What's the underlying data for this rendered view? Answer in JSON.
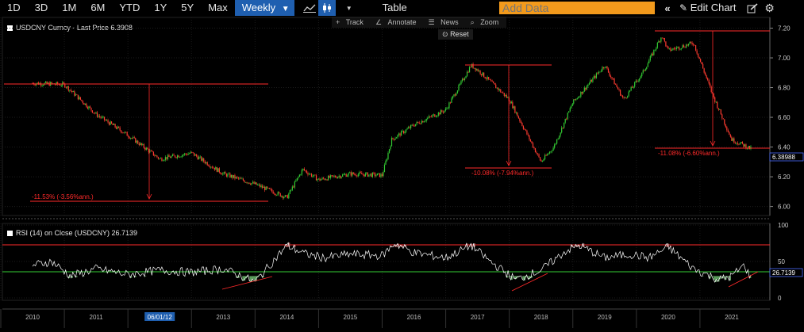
{
  "toolbar": {
    "periods": [
      "1D",
      "3D",
      "1M",
      "6M",
      "YTD",
      "1Y",
      "5Y",
      "Max"
    ],
    "interval": "Weekly",
    "table_label": "Table",
    "add_data_placeholder": "Add Data",
    "edit_chart_label": "Edit Chart"
  },
  "chart_tools": {
    "track": "Track",
    "annotate": "Annotate",
    "news": "News",
    "zoom": "Zoom",
    "reset": "Reset"
  },
  "price_panel": {
    "legend": "USDCNY Curncy - Last Price 6.3908",
    "last_price_tag": "6.38988",
    "y_ticks": [
      "7.20",
      "7.00",
      "6.80",
      "6.60",
      "6.40",
      "6.20",
      "6.00"
    ],
    "annotations": [
      "-11.53% (-3.56%ann.)",
      "-10.08% (-7.94%ann.)",
      "-11.08% (-6.60%ann.)"
    ]
  },
  "rsi_panel": {
    "legend": "RSI (14) on Close (USDCNY) 26.7139",
    "last_value_tag": "26.7139",
    "y_ticks": [
      "100",
      "50",
      "0"
    ]
  },
  "x_axis": {
    "labels": [
      "2010",
      "2011",
      "06/01/12",
      "2013",
      "2014",
      "2015",
      "2016",
      "2017",
      "2018",
      "2019",
      "2020",
      "2021"
    ]
  },
  "colors": {
    "up": "#33cc33",
    "down": "#ff3b30",
    "annotation": "#ff2a2a",
    "rsi_line": "#ffffff",
    "rsi_oversold_fill": "#5a9a5a",
    "rsi_overbought_fill": "#b06060",
    "accent": "#1f5fb0",
    "add_data_bg": "#f29a1c"
  },
  "chart_data": [
    {
      "type": "candlestick",
      "title": "USDCNY Curncy - Last Price 6.3908",
      "ylim": [
        5.95,
        7.24
      ],
      "x": [
        "2010",
        "2010.5",
        "2011",
        "2011.5",
        "2012",
        "2012.5",
        "2013",
        "2013.5",
        "2014",
        "2014.25",
        "2014.5",
        "2015",
        "2015.5",
        "2015.65",
        "2016",
        "2016.5",
        "2016.9",
        "2017",
        "2017.5",
        "2018",
        "2018.2",
        "2018.5",
        "2019",
        "2019.3",
        "2019.6",
        "2019.9",
        "2020",
        "2020.4",
        "2020.7",
        "2021",
        "2021.3"
      ],
      "values": [
        6.83,
        6.82,
        6.62,
        6.48,
        6.32,
        6.36,
        6.22,
        6.15,
        6.06,
        6.25,
        6.18,
        6.22,
        6.21,
        6.45,
        6.55,
        6.65,
        6.95,
        6.92,
        6.72,
        6.3,
        6.4,
        6.7,
        6.95,
        6.72,
        6.9,
        7.15,
        7.05,
        7.1,
        6.75,
        6.45,
        6.39
      ]
    },
    {
      "type": "line",
      "title": "RSI (14) on Close (USDCNY) 26.7139",
      "ylim": [
        0,
        100
      ],
      "x": [
        "2010",
        "2010.3",
        "2010.6",
        "2011",
        "2011.5",
        "2012",
        "2012.5",
        "2013",
        "2013.5",
        "2014",
        "2014.3",
        "2014.6",
        "2015",
        "2015.5",
        "2015.7",
        "2016",
        "2016.5",
        "2016.9",
        "2017.2",
        "2017.6",
        "2018",
        "2018.4",
        "2018.6",
        "2019",
        "2019.4",
        "2019.7",
        "2020",
        "2020.4",
        "2020.8",
        "2021",
        "2021.2",
        "2021.3"
      ],
      "values": [
        45,
        50,
        30,
        40,
        32,
        38,
        35,
        40,
        22,
        72,
        60,
        55,
        60,
        58,
        75,
        62,
        55,
        72,
        50,
        25,
        38,
        65,
        72,
        55,
        60,
        55,
        70,
        40,
        25,
        30,
        45,
        27
      ]
    }
  ]
}
